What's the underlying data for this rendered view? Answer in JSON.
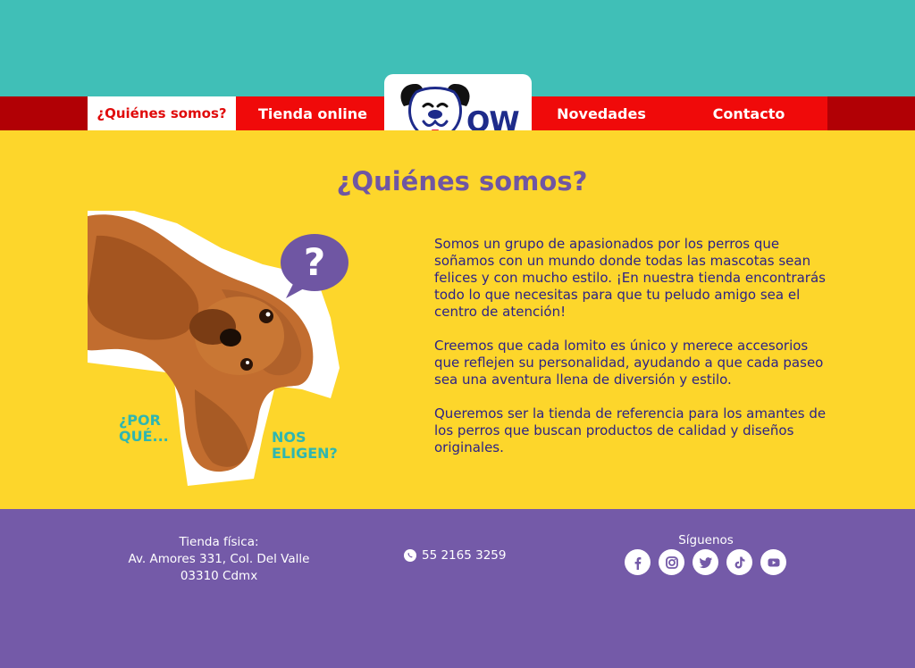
{
  "colors": {
    "teal": "#40bfb7",
    "nav_dark_red": "#b10005",
    "nav_red": "#f00a0a",
    "yellow": "#fdd62b",
    "purple": "#745aa8",
    "title_purple": "#6f56a3",
    "body_navy": "#2d2286",
    "accent_teal_text": "#2fb6b0"
  },
  "nav": {
    "items": [
      {
        "label": "¿Quiénes somos?",
        "active": true
      },
      {
        "label": "Tienda online"
      },
      {
        "label": "Novedades"
      },
      {
        "label": "Contacto"
      }
    ]
  },
  "logo": {
    "text": "OW",
    "icon": "dog-face-logo"
  },
  "page": {
    "title": "¿Quiénes somos?"
  },
  "hero": {
    "image": "dog-photo",
    "bubble_icon": "question-mark-bubble",
    "por_que_line1": "¿POR",
    "por_que_line2": "QUÉ...",
    "nos_eligen_line1": "NOS",
    "nos_eligen_line2": "ELIGEN?"
  },
  "about": {
    "paragraphs": [
      "Somos un grupo de apasionados por los perros que soñamos con un mundo donde todas las mascotas sean felices y con mucho estilo. ¡En nuestra tienda encontrarás todo lo que necesitas para que tu peludo amigo sea el centro de atención!",
      "Creemos que cada lomito es único y merece accesorios que reflejen su personalidad, ayudando a que cada paseo sea una aventura llena de diversión y estilo.",
      "Queremos ser la tienda de referencia para los amantes de los perros que buscan productos de calidad y diseños originales."
    ]
  },
  "footer": {
    "store_label": "Tienda física:",
    "address_line1": "Av. Amores 331, Col. Del Valle",
    "address_line2": "03310 Cdmx",
    "phone": "55 2165 3259",
    "phone_icon": "whatsapp-icon",
    "follow_label": "Síguenos",
    "socials": [
      "facebook-icon",
      "instagram-icon",
      "twitter-icon",
      "tiktok-icon",
      "youtube-icon"
    ]
  }
}
